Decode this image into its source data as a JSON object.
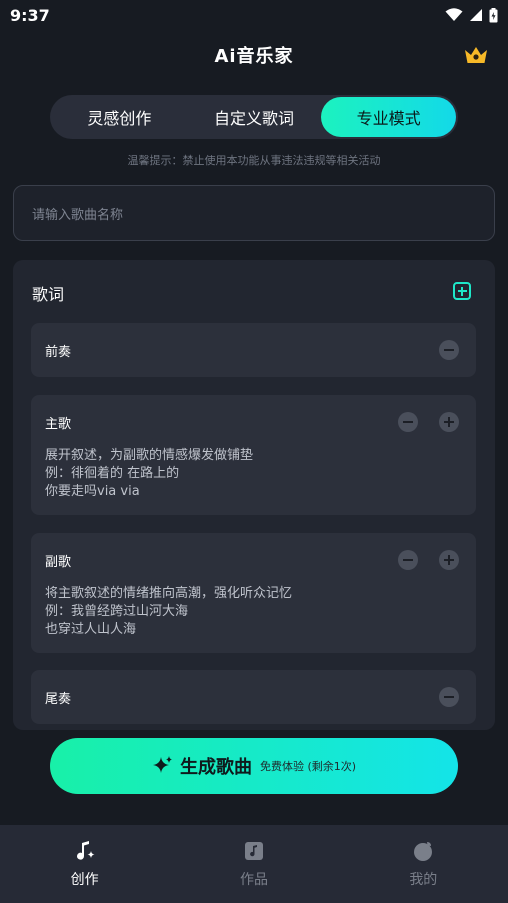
{
  "status_bar": {
    "time": "9:37"
  },
  "header": {
    "title": "Ai音乐家"
  },
  "mode_tabs": [
    {
      "label": "灵感创作",
      "active": false
    },
    {
      "label": "自定义歌词",
      "active": false
    },
    {
      "label": "专业模式",
      "active": true
    }
  ],
  "warning": "温馨提示：禁止使用本功能从事违法违规等相关活动",
  "song_name": {
    "placeholder": "请输入歌曲名称",
    "value": ""
  },
  "lyrics": {
    "title": "歌词",
    "sections": [
      {
        "label": "前奏",
        "hint_lines": []
      },
      {
        "label": "主歌",
        "hint_lines": [
          "展开叙述，为副歌的情感爆发做铺垫",
          "例：徘徊着的 在路上的",
          "你要走吗via via"
        ]
      },
      {
        "label": "副歌",
        "hint_lines": [
          "将主歌叙述的情绪推向高潮，强化听众记忆",
          "例：我曾经跨过山河大海",
          "也穿过人山人海"
        ]
      },
      {
        "label": "尾奏",
        "hint_lines": []
      }
    ]
  },
  "generate": {
    "label": "生成歌曲",
    "sub": "免费体验 (剩余1次)"
  },
  "bottom_nav": [
    {
      "label": "创作",
      "icon": "music-note-sparkle-icon",
      "active": true
    },
    {
      "label": "作品",
      "icon": "music-album-icon",
      "active": false
    },
    {
      "label": "我的",
      "icon": "profile-icon",
      "active": false
    }
  ],
  "colors": {
    "accent": "#1cf2bf",
    "background": "#171b22",
    "panel": "#222630"
  }
}
